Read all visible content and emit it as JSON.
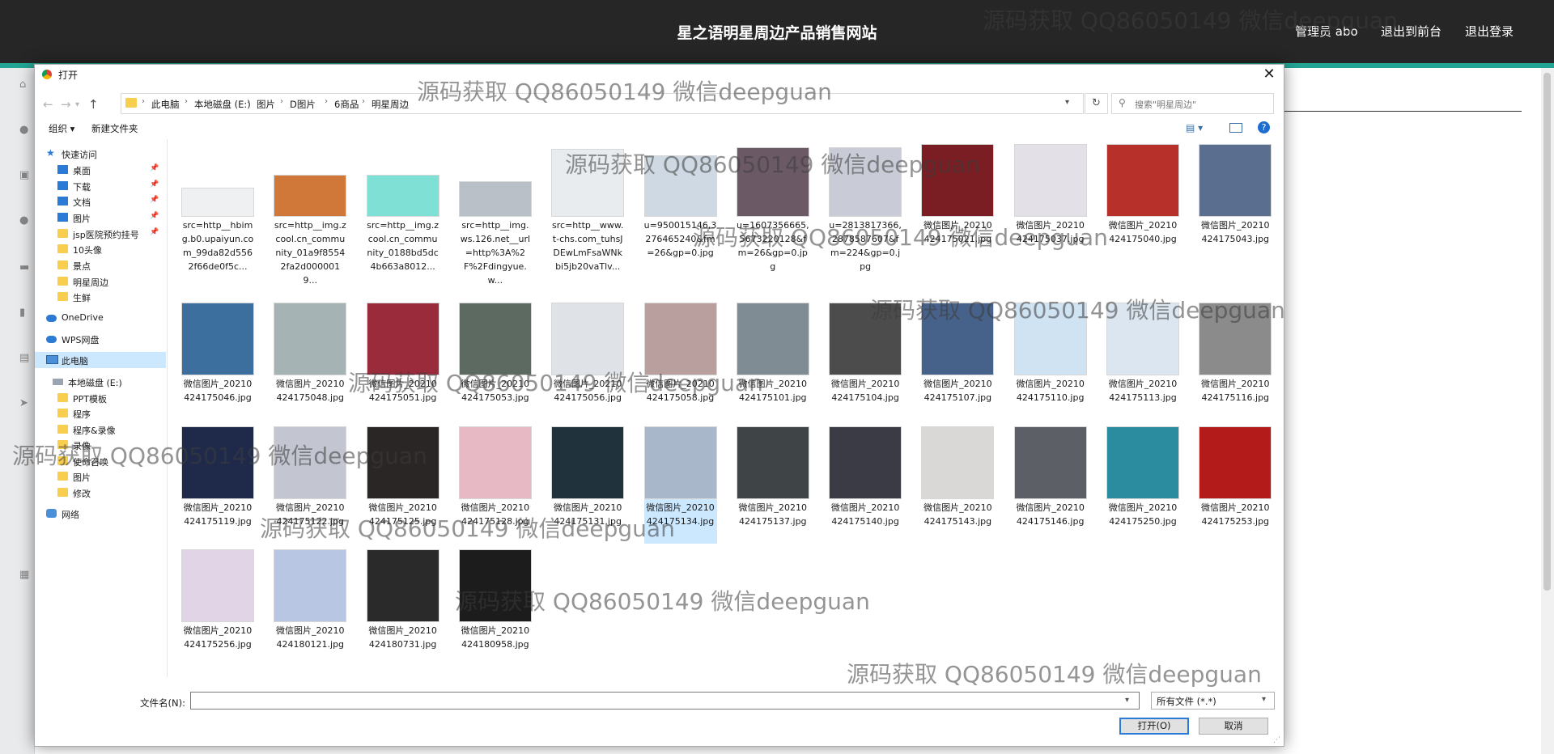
{
  "site": {
    "title": "星之语明星周边产品销售网站",
    "admin_label": "管理员 abo",
    "front_link": "退出到前台",
    "logout_link": "退出登录"
  },
  "dialog": {
    "title": "打开",
    "breadcrumb": [
      "此电脑",
      "本地磁盘 (E:)",
      "图片",
      "D图片",
      "6商品",
      "明星周边"
    ],
    "search_placeholder": "搜索\"明星周边\"",
    "toolbar": {
      "organize": "组织 ▾",
      "new_folder": "新建文件夹"
    },
    "nav_items": [
      {
        "label": "快速访问",
        "icon": "star-icon",
        "pinned": false
      },
      {
        "label": "桌面",
        "icon": "desktop-icon",
        "pinned": true
      },
      {
        "label": "下载",
        "icon": "download-icon",
        "pinned": true
      },
      {
        "label": "文档",
        "icon": "document-icon",
        "pinned": true
      },
      {
        "label": "图片",
        "icon": "pictures-icon",
        "pinned": true
      },
      {
        "label": "jsp医院预约挂号",
        "icon": "folder-icon",
        "pinned": true
      },
      {
        "label": "10头像",
        "icon": "folder-icon",
        "pinned": false
      },
      {
        "label": "景点",
        "icon": "folder-icon",
        "pinned": false
      },
      {
        "label": "明星周边",
        "icon": "folder-icon",
        "pinned": false
      },
      {
        "label": "生鲜",
        "icon": "folder-icon",
        "pinned": false
      },
      {
        "label": "OneDrive",
        "icon": "cloud-icon",
        "pinned": false
      },
      {
        "label": "WPS网盘",
        "icon": "cloud-icon",
        "pinned": false
      },
      {
        "label": "此电脑",
        "icon": "pc-icon",
        "pinned": false
      },
      {
        "label": "本地磁盘 (E:)",
        "icon": "drive-icon",
        "pinned": false
      },
      {
        "label": "PPT模板",
        "icon": "folder-icon",
        "pinned": false
      },
      {
        "label": "程序",
        "icon": "folder-icon",
        "pinned": false
      },
      {
        "label": "程序&录像",
        "icon": "folder-icon",
        "pinned": false
      },
      {
        "label": "录像",
        "icon": "folder-icon",
        "pinned": false
      },
      {
        "label": "使命召唤",
        "icon": "folder-icon",
        "pinned": false
      },
      {
        "label": "图片",
        "icon": "folder-icon",
        "pinned": false
      },
      {
        "label": "修改",
        "icon": "folder-icon",
        "pinned": false
      },
      {
        "label": "网络",
        "icon": "network-icon",
        "pinned": false
      }
    ],
    "files": [
      {
        "name": "src=http__hbimg.b0.upaiyun.com_99da82d5562f66de0f5c...",
        "color": "#eef0f2"
      },
      {
        "name": "src=http__img.zcool.cn_community_01a9f85542fa2d0000019...",
        "color": "#d0783a"
      },
      {
        "name": "src=http__img.zcool.cn_community_0188bd5dc4b663a8012...",
        "color": "#7fe0d6"
      },
      {
        "name": "src=http__img.ws.126.net__url=http%3A%2F%2Fdingyue.w...",
        "color": "#b9c0c8"
      },
      {
        "name": "src=http__www.t-chs.com_tuhsJDEwLmFsaWNkbi5jb20vaTlv...",
        "color": "#e8ecef"
      },
      {
        "name": "u=950015146,3276465240&fm=26&gp=0.jpg",
        "color": "#cfd9e3"
      },
      {
        "name": "u=1607356665,5673220128&fm=26&gp=0.jpg",
        "color": "#6b5a66"
      },
      {
        "name": "u=2813817366,2878587607&fm=224&gp=0.jpg",
        "color": "#c9ccd6"
      },
      {
        "name": "微信图片_20210424175021.jpg",
        "color": "#7a1e24"
      },
      {
        "name": "微信图片_20210424175037.jpg",
        "color": "#e3e0e8"
      },
      {
        "name": "微信图片_20210424175040.jpg",
        "color": "#b8302a"
      },
      {
        "name": "微信图片_20210424175043.jpg",
        "color": "#5a6f8f"
      },
      {
        "name": "微信图片_20210424175046.jpg",
        "color": "#3d6f9e"
      },
      {
        "name": "微信图片_20210424175048.jpg",
        "color": "#a6b3b4"
      },
      {
        "name": "微信图片_20210424175051.jpg",
        "color": "#9a2b3a"
      },
      {
        "name": "微信图片_20210424175053.jpg",
        "color": "#5d6a62"
      },
      {
        "name": "微信图片_20210424175056.jpg",
        "color": "#dfe3e8"
      },
      {
        "name": "微信图片_20210424175058.jpg",
        "color": "#b9a09e"
      },
      {
        "name": "微信图片_20210424175101.jpg",
        "color": "#7f8c94"
      },
      {
        "name": "微信图片_20210424175104.jpg",
        "color": "#4c4c4c"
      },
      {
        "name": "微信图片_20210424175107.jpg",
        "color": "#47628a"
      },
      {
        "name": "微信图片_20210424175110.jpg",
        "color": "#cfe3f3"
      },
      {
        "name": "微信图片_20210424175113.jpg",
        "color": "#dbe6f0"
      },
      {
        "name": "微信图片_20210424175116.jpg",
        "color": "#8b8b8b"
      },
      {
        "name": "微信图片_20210424175119.jpg",
        "color": "#1f2a4a"
      },
      {
        "name": "微信图片_20210424175122.jpg",
        "color": "#c3c6d1"
      },
      {
        "name": "微信图片_20210424175125.jpg",
        "color": "#2a2625"
      },
      {
        "name": "微信图片_20210424175128.jpg",
        "color": "#e6b9c4"
      },
      {
        "name": "微信图片_20210424175131.jpg",
        "color": "#20323b"
      },
      {
        "name": "微信图片_20210424175134.jpg",
        "color": "#a8b7c9"
      },
      {
        "name": "微信图片_20210424175137.jpg",
        "color": "#3f4547"
      },
      {
        "name": "微信图片_20210424175140.jpg",
        "color": "#3b3b46"
      },
      {
        "name": "微信图片_20210424175143.jpg",
        "color": "#d9d8d6"
      },
      {
        "name": "微信图片_20210424175146.jpg",
        "color": "#5c6066"
      },
      {
        "name": "微信图片_20210424175250.jpg",
        "color": "#2b8ca0"
      },
      {
        "name": "微信图片_20210424175253.jpg",
        "color": "#b31a1a"
      },
      {
        "name": "微信图片_20210424175256.jpg",
        "color": "#e1d4e6"
      },
      {
        "name": "微信图片_20210424180121.jpg",
        "color": "#b9c6e3"
      },
      {
        "name": "微信图片_20210424180731.jpg",
        "color": "#2a2a2a"
      },
      {
        "name": "微信图片_20210424180958.jpg",
        "color": "#1c1c1c"
      }
    ],
    "selected_file_index": 29,
    "filename_label": "文件名(N):",
    "filename_value": "",
    "filter_value": "所有文件 (*.*)",
    "open_button": "打开(O)",
    "cancel_button": "取消"
  },
  "watermark": "源码获取 QQ86050149 微信deepguan"
}
